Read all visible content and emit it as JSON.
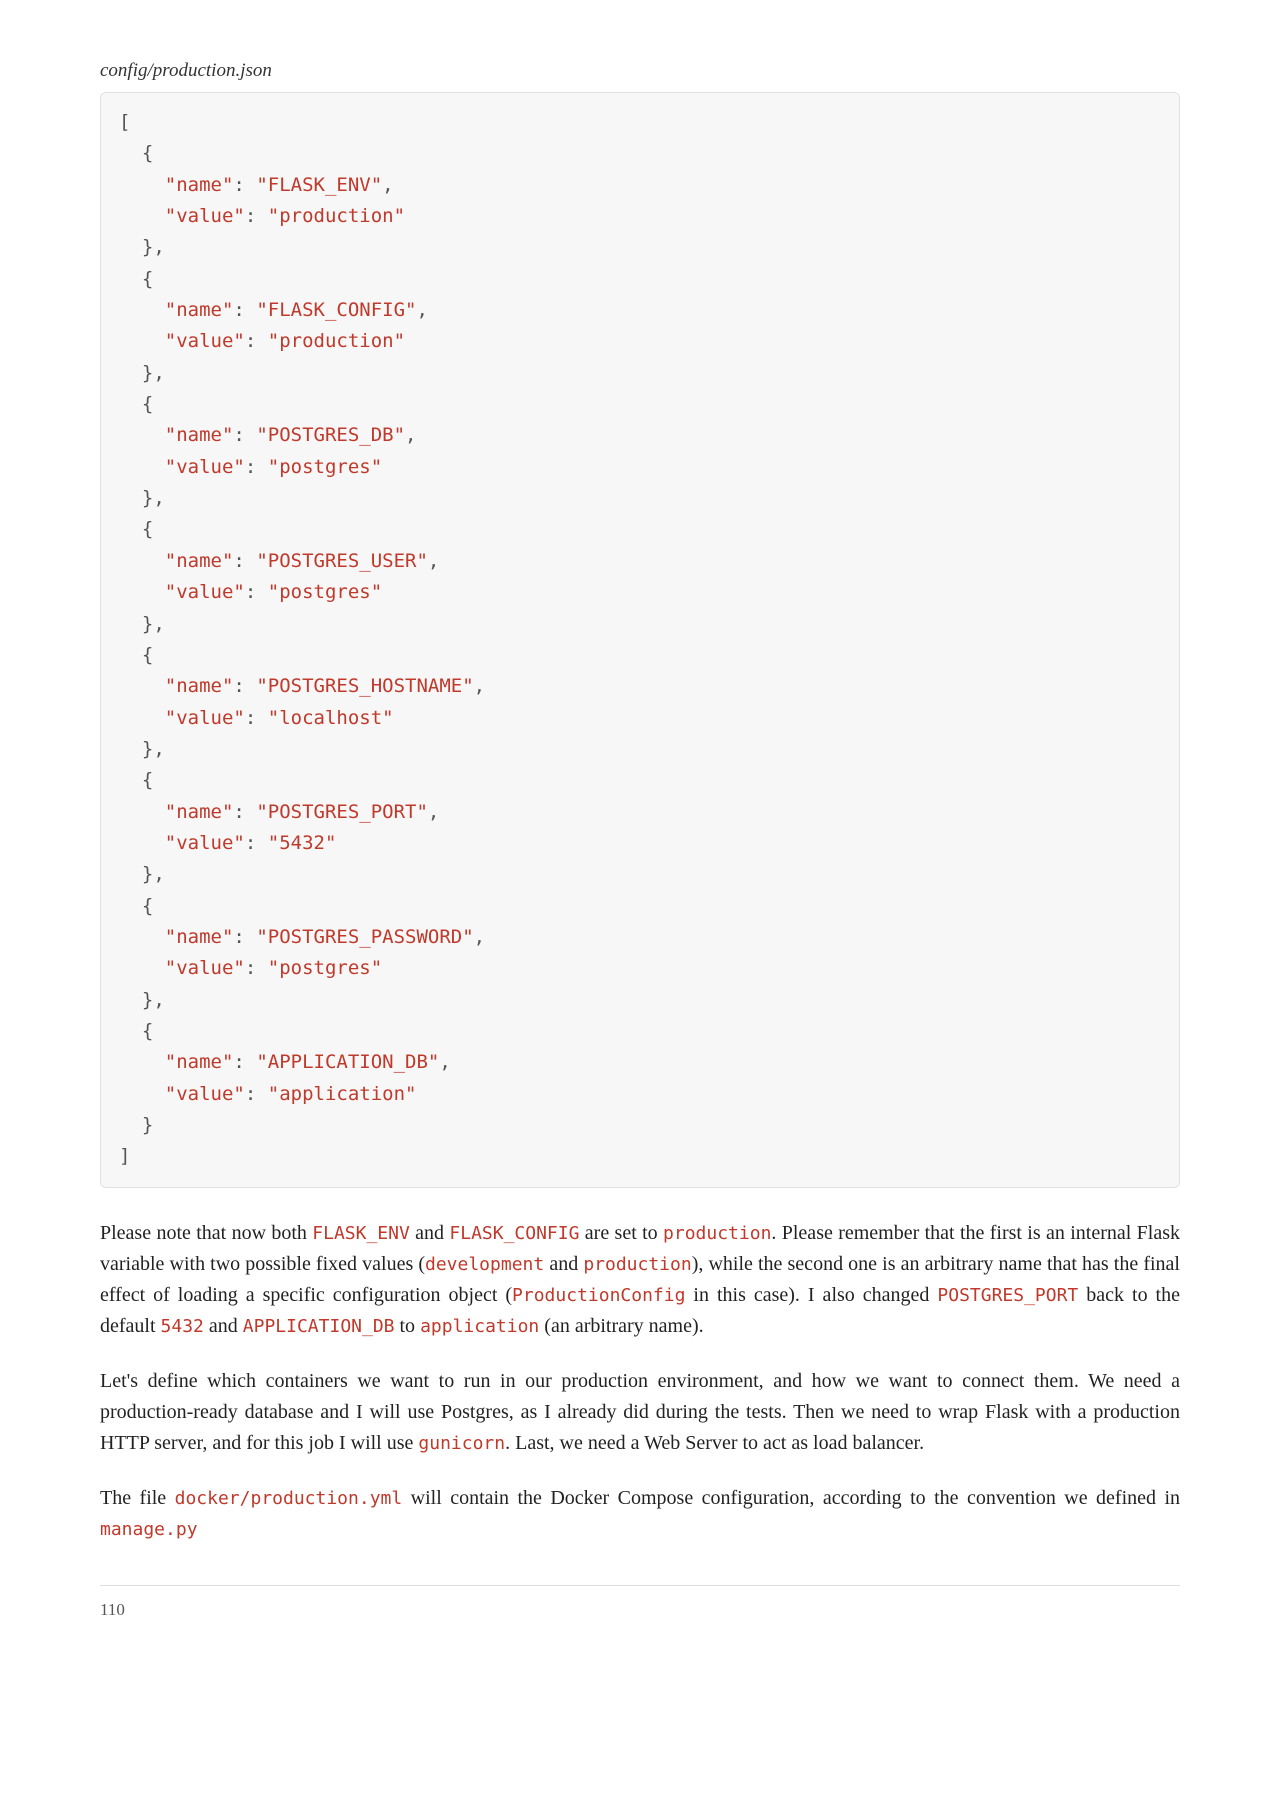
{
  "filepath": "config/production.json",
  "config_entries": [
    {
      "name": "FLASK_ENV",
      "value": "production"
    },
    {
      "name": "FLASK_CONFIG",
      "value": "production"
    },
    {
      "name": "POSTGRES_DB",
      "value": "postgres"
    },
    {
      "name": "POSTGRES_USER",
      "value": "postgres"
    },
    {
      "name": "POSTGRES_HOSTNAME",
      "value": "localhost"
    },
    {
      "name": "POSTGRES_PORT",
      "value": "5432"
    },
    {
      "name": "POSTGRES_PASSWORD",
      "value": "postgres"
    },
    {
      "name": "APPLICATION_DB",
      "value": "application"
    }
  ],
  "para1": {
    "t0": "Please note that now both ",
    "c0": "FLASK_ENV",
    "t1": " and ",
    "c1": "FLASK_CONFIG",
    "t2": " are set to ",
    "c2": "production",
    "t3": ". Please remember that the first is an internal Flask variable with two possible fixed values (",
    "c3": "development",
    "t4": " and ",
    "c4": "production",
    "t5": "), while the second one is an arbitrary name that has the final effect of loading a specific configuration object (",
    "c5": "ProductionConfig",
    "t6": " in this case). I also changed ",
    "c6": "POSTGRES_PORT",
    "t7": " back to the default ",
    "c7": "5432",
    "t8": " and ",
    "c8": "APPLICATION_DB",
    "t9": " to ",
    "c9": "application",
    "t10": " (an arbitrary name)."
  },
  "para2": {
    "t0": "Let's define which containers we want to run in our production environment, and how we want to connect them. We need a production-ready database and I will use Postgres, as I already did during the tests. Then we need to wrap Flask with a production HTTP server, and for this job I will use ",
    "c0": "gunicorn",
    "t1": ". Last, we need a Web Server to act as load balancer."
  },
  "para3": {
    "t0": "The file ",
    "c0": "docker/production.yml",
    "t1": " will contain the Docker Compose configuration, according to the convention we defined in ",
    "c1": "manage.py"
  },
  "page_number": "110"
}
